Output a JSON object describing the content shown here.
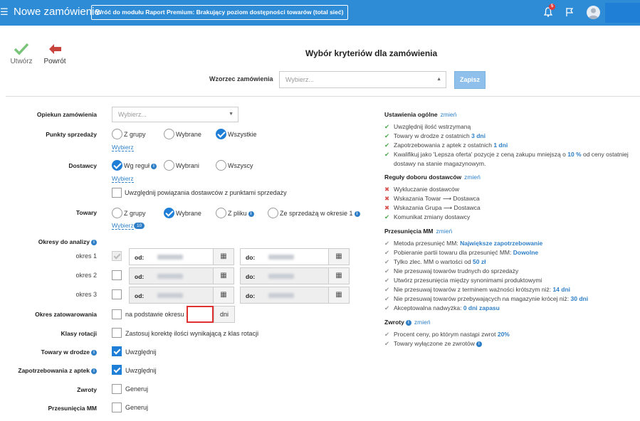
{
  "header": {
    "title": "Nowe zamówienie",
    "back_label": "Wróć do modułu Raport Premium: Brakujący poziom dostępności towarów (total sieć)",
    "notif_count": "5"
  },
  "actions": {
    "create": "Utwórz",
    "back": "Powrót"
  },
  "page": {
    "title": "Wybór kryteriów dla zamówienia",
    "template_label": "Wzorzec zamówienia",
    "template_placeholder": "Wybierz...",
    "save": "Zapisz"
  },
  "form": {
    "guardian": {
      "label": "Opiekun zamówienia",
      "placeholder": "Wybierz..."
    },
    "points": {
      "label": "Punkty sprzedaży",
      "options": [
        "Z grupy",
        "Wybrane",
        "Wszystkie"
      ],
      "selected": 2,
      "link": "Wybierz"
    },
    "suppliers": {
      "label": "Dostawcy",
      "options": [
        "Wg reguł",
        "Wybrani",
        "Wszyscy"
      ],
      "selected": 0,
      "link": "Wybierz",
      "checkbox": "Uwzględnij powiązania dostawców z punktami sprzedaży"
    },
    "goods": {
      "label": "Towary",
      "options": [
        "Z grupy",
        "Wybrane",
        "Z pliku",
        "Ze sprzedażą w okresie 1"
      ],
      "selected": 1,
      "link": "Wybierz",
      "count": "10"
    },
    "periods": {
      "label": "Okresy do analizy",
      "rows": [
        "okres 1",
        "okres 2",
        "okres 3"
      ],
      "from": "od:",
      "to": "do:"
    },
    "stock": {
      "label": "Okres zatowarowania",
      "text": "na podstawie okresu 1",
      "unit": "dni"
    },
    "rotation": {
      "label": "Klasy rotacji",
      "text": "Zastosuj korektę ilości wynikającą z klas rotacji"
    },
    "in_transit": {
      "label": "Towary w drodze",
      "text": "Uwzględnij"
    },
    "pharmacy": {
      "label": "Zapotrzebowania z aptek",
      "text": "Uwzględnij"
    },
    "returns": {
      "label": "Zwroty",
      "text": "Generuj"
    },
    "mm": {
      "label": "Przesunięcia MM",
      "text": "Generuj"
    }
  },
  "right": {
    "change": "zmień",
    "general": {
      "title": "Ustawienia ogólne",
      "items": [
        {
          "t": "Uwzględnij ilość wstrzymaną",
          "v": ""
        },
        {
          "t": "Towary w drodze z ostatnich",
          "v": "3 dni"
        },
        {
          "t": "Zapotrzebowania z aptek z ostatnich",
          "v": "1 dni"
        },
        {
          "t": "Kwalifikuj jako 'Lepsza oferta' pozycje z ceną zakupu mniejszą o",
          "v": "10 %",
          "t2": "od ceny ostatniej"
        },
        {
          "t": "dostawy na stanie magazynowym.",
          "v": ""
        }
      ]
    },
    "rules": {
      "title": "Reguły doboru dostawców",
      "items": [
        {
          "t": "Wykluczanie dostawców",
          "m": "x"
        },
        {
          "t": "Wskazania Towar ⟶ Dostawca",
          "m": "x"
        },
        {
          "t": "Wskazania Grupa ⟶ Dostawca",
          "m": "x"
        },
        {
          "t": "Komunikat zmiany dostawcy",
          "m": "v"
        }
      ]
    },
    "mm": {
      "title": "Przesunięcia MM",
      "items": [
        {
          "t": "Metoda przesunięć MM:",
          "v": "Największe zapotrzebowanie"
        },
        {
          "t": "Pobieranie partii towaru dla przesunięć MM:",
          "v": "Dowolne"
        },
        {
          "t": "Tylko zlec. MM o wartości od",
          "v": "50 zł"
        },
        {
          "t": "Nie przesuwaj towarów trudnych do sprzedaży",
          "v": ""
        },
        {
          "t": "Utwórz przesunięcia między synonimami produktowymi",
          "v": ""
        },
        {
          "t": "Nie przesuwaj towarów z terminem ważności krótszym niż:",
          "v": "14 dni"
        },
        {
          "t": "Nie przesuwaj towarów przebywających na magazynie krócej niż:",
          "v": "30 dni"
        },
        {
          "t": "Akceptowalna nadwyżka:",
          "v": "0 dni zapasu"
        }
      ]
    },
    "returns": {
      "title": "Zwroty",
      "items": [
        {
          "t": "Procent ceny, po którym nastąpi zwrot",
          "v": "20%"
        },
        {
          "t": "Towary wyłączone ze zwrotów",
          "v": ""
        }
      ]
    }
  }
}
